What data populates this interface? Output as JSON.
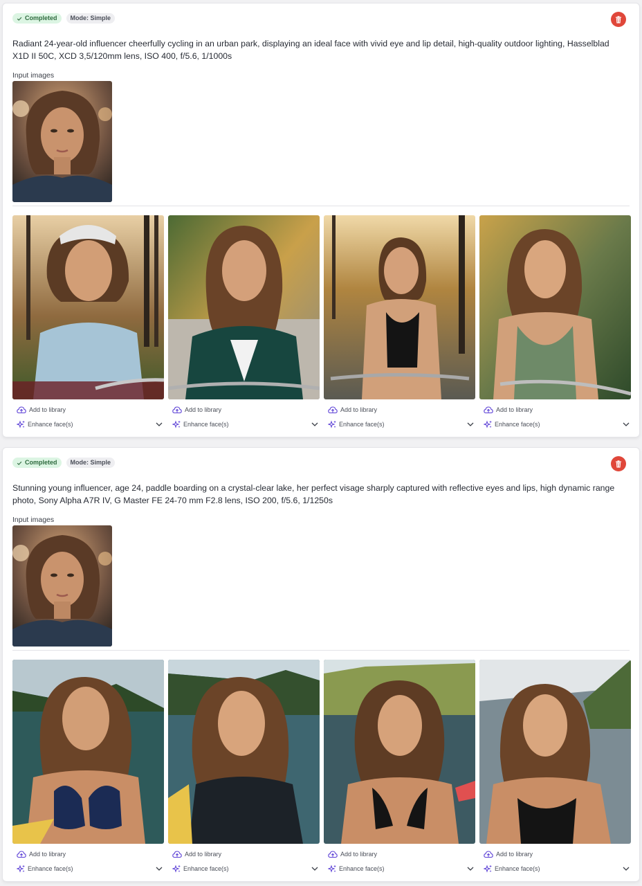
{
  "colors": {
    "accent": "#5b3fd6",
    "delete": "#e0473a",
    "completed_bg": "#dcf5e3",
    "completed_text": "#2f6b3f"
  },
  "jobs": [
    {
      "status": "Completed",
      "mode": "Mode: Simple",
      "prompt": "Radiant 24-year-old influencer cheerfully cycling in an urban park, displaying an ideal face with vivid eye and lip detail, high-quality outdoor lighting, Hasselblad X1D II 50C, XCD 3,5/120mm lens, ISO 400, f/5.6, 1/1000s",
      "input_label": "Input images",
      "input_image": "portrait of young woman with shoulder-length wavy brown hair, bokeh background",
      "outputs": [
        {
          "scene": "woman in light blue t-shirt and bike helmet cycling in autumn park",
          "add_label": "Add to library",
          "enhance_label": "Enhance face(s)"
        },
        {
          "scene": "woman in green blazer and white top cycling in autumn park",
          "add_label": "Add to library",
          "enhance_label": "Enhance face(s)"
        },
        {
          "scene": "woman in black tank top cycling on park path",
          "add_label": "Add to library",
          "enhance_label": "Enhance face(s)"
        },
        {
          "scene": "woman in olive green tank top cycling in park",
          "add_label": "Add to library",
          "enhance_label": "Enhance face(s)"
        }
      ]
    },
    {
      "status": "Completed",
      "mode": "Mode: Simple",
      "prompt": "Stunning young influencer, age 24, paddle boarding on a crystal-clear lake, her perfect visage sharply captured with reflective eyes and lips, high dynamic range photo, Sony Alpha A7R IV, G Master FE 24-70 mm F2.8 lens, ISO 200, f/5.6, 1/1250s",
      "input_label": "Input images",
      "input_image": "portrait of young woman with shoulder-length wavy brown hair, bokeh background",
      "outputs": [
        {
          "scene": "woman in navy bikini on paddle board on lake with forested hills",
          "add_label": "Add to library",
          "enhance_label": "Enhance face(s)"
        },
        {
          "scene": "woman in black wetsuit on paddle board on mountain lake",
          "add_label": "Add to library",
          "enhance_label": "Enhance face(s)"
        },
        {
          "scene": "woman in black swimsuit on lake with green hills",
          "add_label": "Add to library",
          "enhance_label": "Enhance face(s)"
        },
        {
          "scene": "woman in black swimsuit on lake with cliffs",
          "add_label": "Add to library",
          "enhance_label": "Enhance face(s)"
        }
      ]
    }
  ]
}
